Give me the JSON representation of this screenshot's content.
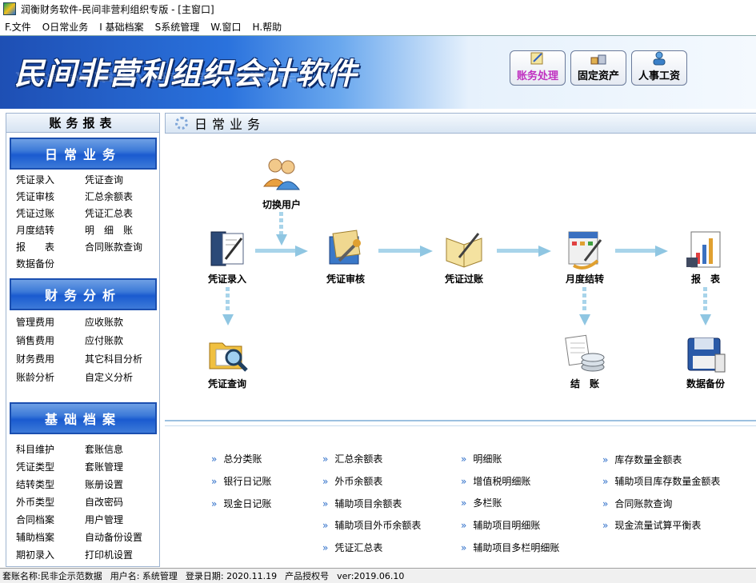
{
  "window": {
    "title": "润衡财务软件-民间非营利组织专版 - [主窗口]"
  },
  "menu": [
    "F.文件",
    "O日常业务",
    "I 基础档案",
    "S系统管理",
    "W.窗口",
    "H.帮助"
  ],
  "banner": {
    "title": "民间非营利组织会计软件",
    "buttons": [
      {
        "label": "账务处理",
        "icon": "accounting-icon",
        "color": "#c030c0"
      },
      {
        "label": "固定资产",
        "icon": "fixed-assets-icon"
      },
      {
        "label": "人事工资",
        "icon": "payroll-icon"
      }
    ]
  },
  "left": {
    "header": "账务报表",
    "sections": [
      {
        "title": "日常业务",
        "items": [
          "凭证录入",
          "凭证查询",
          "凭证审核",
          "汇总余额表",
          "凭证过账",
          "凭证汇总表",
          "月度结转",
          "明　细　账",
          "报　　表",
          "合同账款查询",
          "数据备份"
        ]
      },
      {
        "title": "财务分析",
        "items": [
          "管理费用",
          "应收账款",
          "销售费用",
          "应付账款",
          "财务费用",
          "其它科目分析",
          "账龄分析",
          "自定义分析"
        ]
      },
      {
        "title": "基础档案",
        "items": [
          "科目维护",
          "套账信息",
          "凭证类型",
          "套账管理",
          "结转类型",
          "账册设置",
          "外币类型",
          "自改密码",
          "合同档案",
          "用户管理",
          "辅助档案",
          "自动备份设置",
          "期初录入",
          "打印机设置"
        ]
      }
    ]
  },
  "main": {
    "header": "日常业务",
    "flow": {
      "switch_user": "切换用户",
      "voucher_entry": "凭证录入",
      "voucher_audit": "凭证审核",
      "voucher_post": "凭证过账",
      "month_close": "月度结转",
      "reports": "报　表",
      "voucher_query": "凭证查询",
      "close_books": "结　账",
      "data_backup": "数据备份"
    },
    "reports": [
      [
        "总分类账",
        "银行日记账",
        "现金日记账"
      ],
      [
        "汇总余额表",
        "外币余额表",
        "辅助项目余额表",
        "辅助项目外币余额表",
        "凭证汇总表"
      ],
      [
        "明细账",
        "增值税明细账",
        "多栏账",
        "辅助项目明细账",
        "辅助项目多栏明细账"
      ],
      [
        "库存数量金额表",
        "辅助项目库存数量金额表",
        "合同账款查询",
        "现金流量试算平衡表"
      ]
    ]
  },
  "status": {
    "account": "套账名称:民非企示范数据",
    "user": "用户名: 系统管理",
    "date": "登录日期: 2020.11.19",
    "license": "产品授权号",
    "version": "ver:2019.06.10"
  },
  "colors": {
    "accent": "#1a5bd0",
    "banner_start": "#1e4fb4",
    "link_bullet": "#2a6cc8",
    "panel_border": "#9fb4d0"
  }
}
